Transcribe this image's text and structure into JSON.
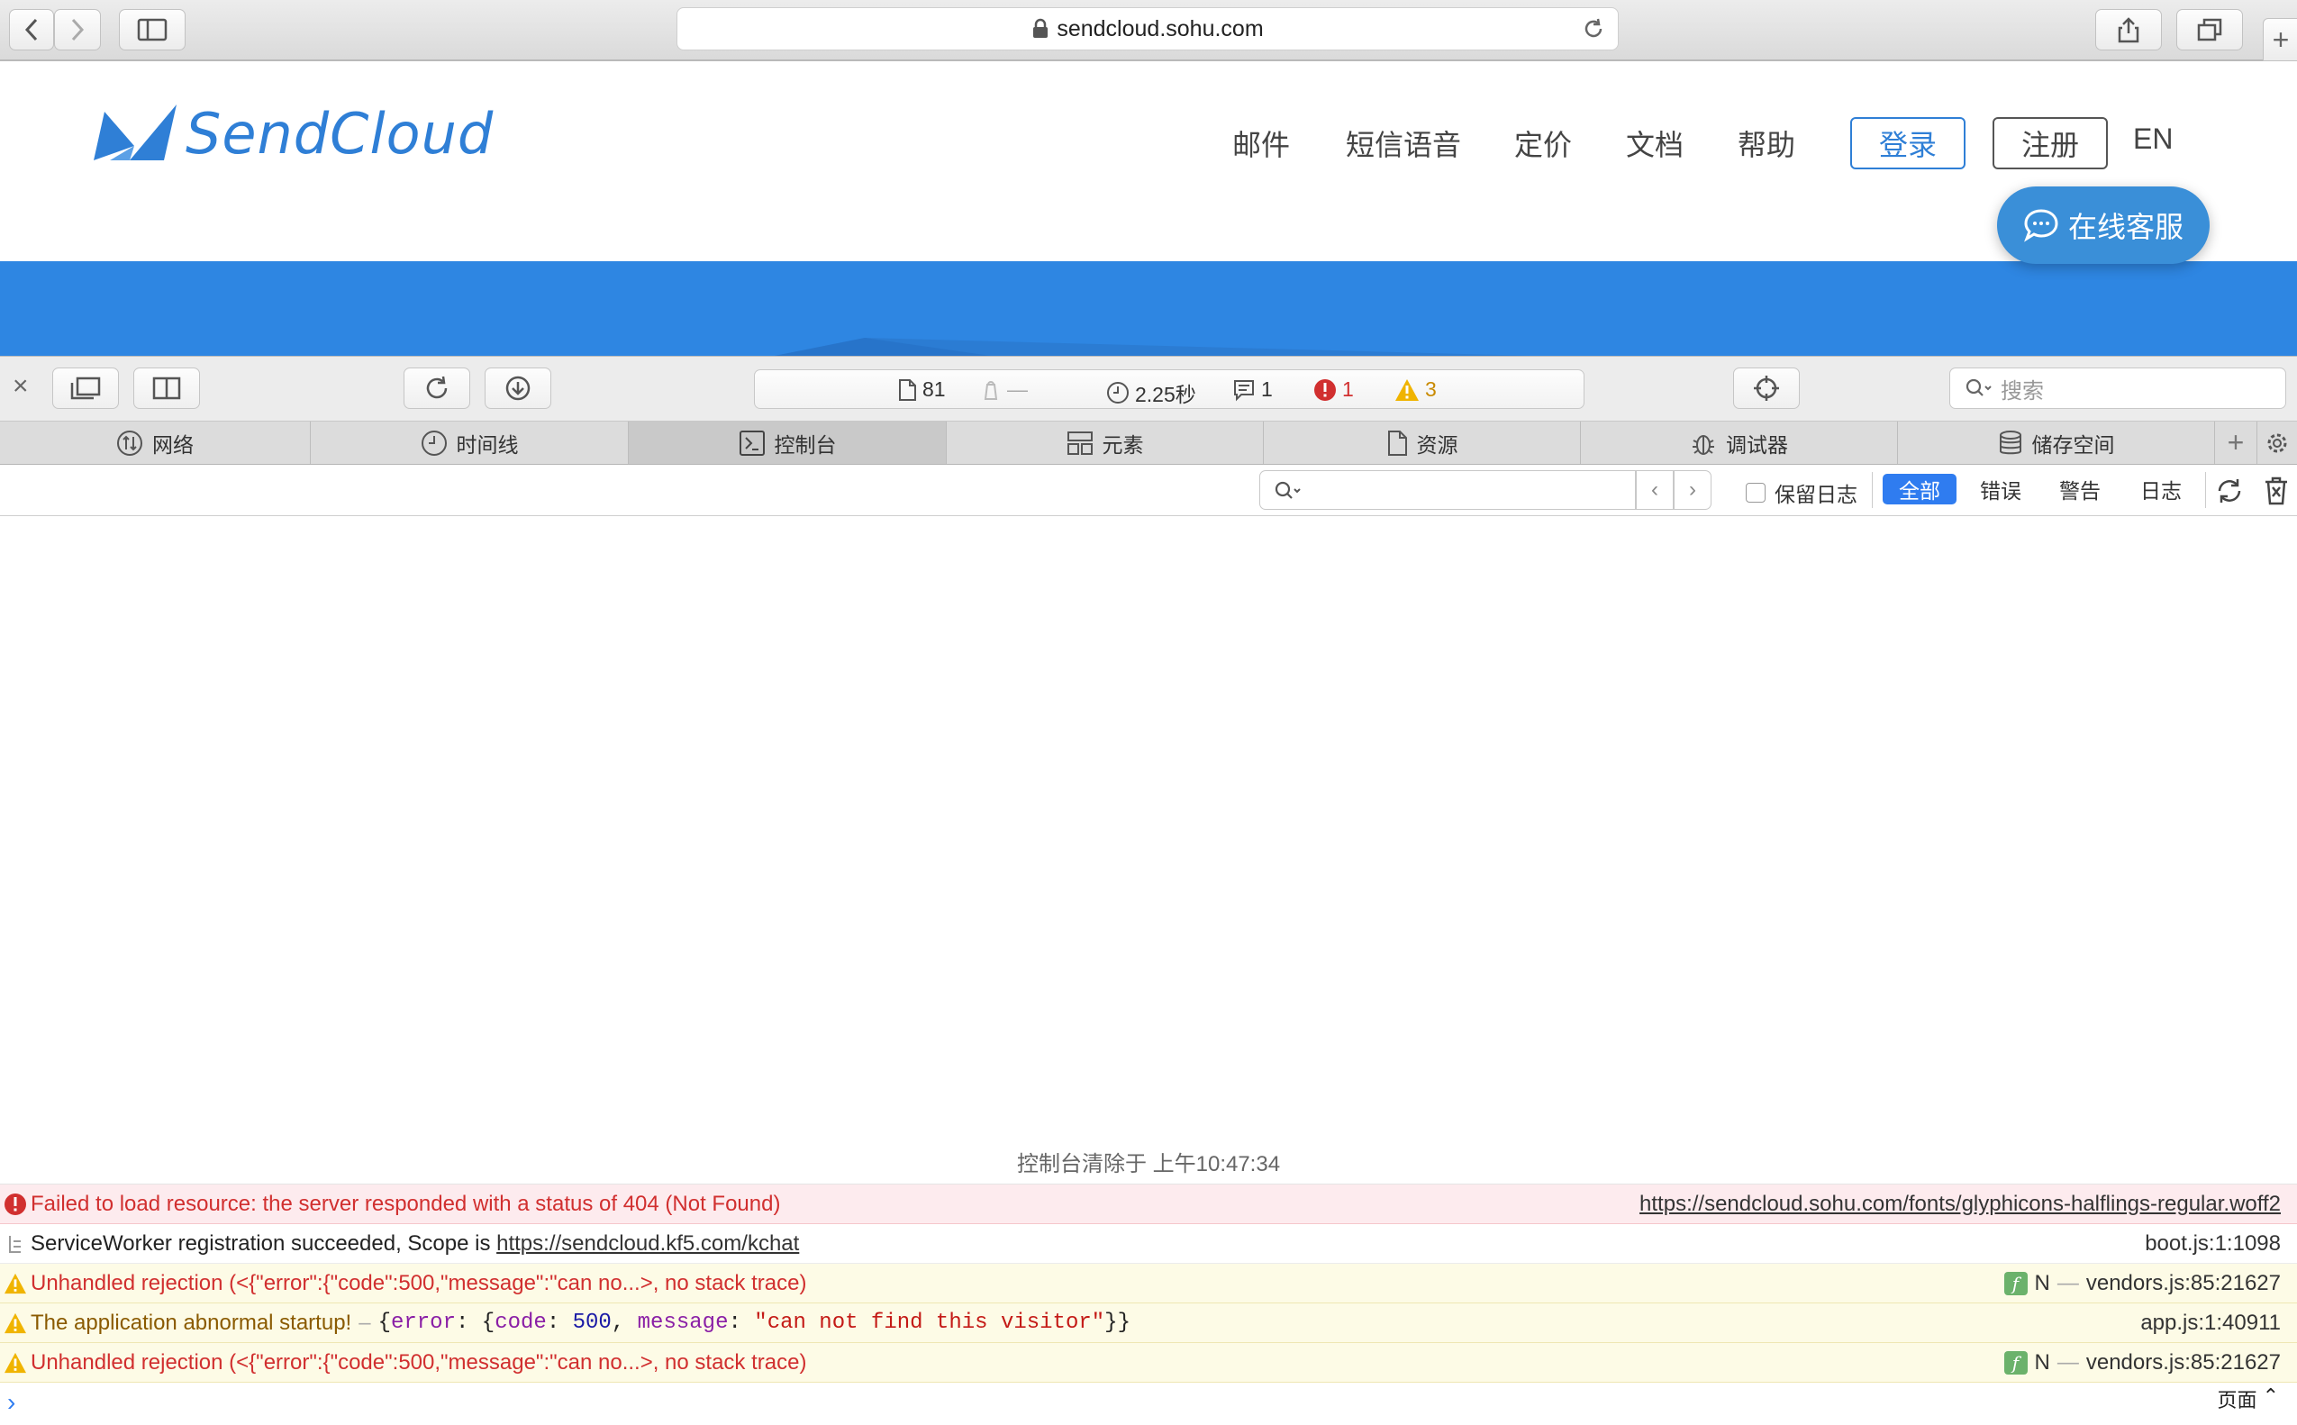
{
  "browser": {
    "url": "sendcloud.sohu.com"
  },
  "site": {
    "logo_text": "SendCloud",
    "nav": [
      "邮件",
      "短信语音",
      "定价",
      "文档",
      "帮助"
    ],
    "login_label": "登录",
    "register_label": "注册",
    "lang_label": "EN",
    "chat_label": "在线客服",
    "colors": {
      "brand": "#2f7fd6",
      "banner": "#2e86e2"
    }
  },
  "devtools": {
    "dashboard": {
      "resources": "81",
      "bytes": "—",
      "load_time": "2.25秒",
      "logs": "1",
      "errors": "1",
      "warnings": "3"
    },
    "search_placeholder": "搜索",
    "tabs": [
      {
        "label": "网络",
        "icon": "network-icon"
      },
      {
        "label": "时间线",
        "icon": "timeline-icon"
      },
      {
        "label": "控制台",
        "icon": "console-icon"
      },
      {
        "label": "元素",
        "icon": "elements-icon"
      },
      {
        "label": "资源",
        "icon": "resources-icon"
      },
      {
        "label": "调试器",
        "icon": "debugger-icon"
      },
      {
        "label": "储存空间",
        "icon": "storage-icon"
      }
    ],
    "filter": {
      "preserve_log": "保留日志",
      "levels": [
        "全部",
        "错误",
        "警告",
        "日志"
      ],
      "active_level": "全部"
    }
  },
  "console": {
    "cleared_note": "控制台清除于 上午10:47:34",
    "messages": [
      {
        "type": "error",
        "text": "Failed to load resource: the server responded with a status of 404 (Not Found)",
        "source": "https://sendcloud.sohu.com/fonts/glyphicons-halflings-regular.woff2"
      },
      {
        "type": "log",
        "text": "ServiceWorker registration succeeded, Scope is ",
        "link": "https://sendcloud.kf5.com/kchat",
        "source": "boot.js:1:1098"
      },
      {
        "type": "warn",
        "text": "Unhandled rejection (<{\"error\":{\"code\":500,\"message\":\"can no...>, no stack trace)",
        "badge": "N",
        "source": "vendors.js:85:21627"
      },
      {
        "type": "warn",
        "text": "The application abnormal startup!",
        "source": "app.js:1:40911"
      },
      {
        "type": "warn",
        "text": "Unhandled rejection (<{\"error\":{\"code\":500,\"message\":\"can no...>, no stack trace)",
        "badge": "N",
        "source": "vendors.js:85:21627"
      }
    ],
    "object_preview": {
      "error_key": "error",
      "code_key": "code",
      "code_val": "500",
      "message_key": "message",
      "message_val": "\"can not find this visitor\""
    },
    "footer_label": "页面"
  }
}
